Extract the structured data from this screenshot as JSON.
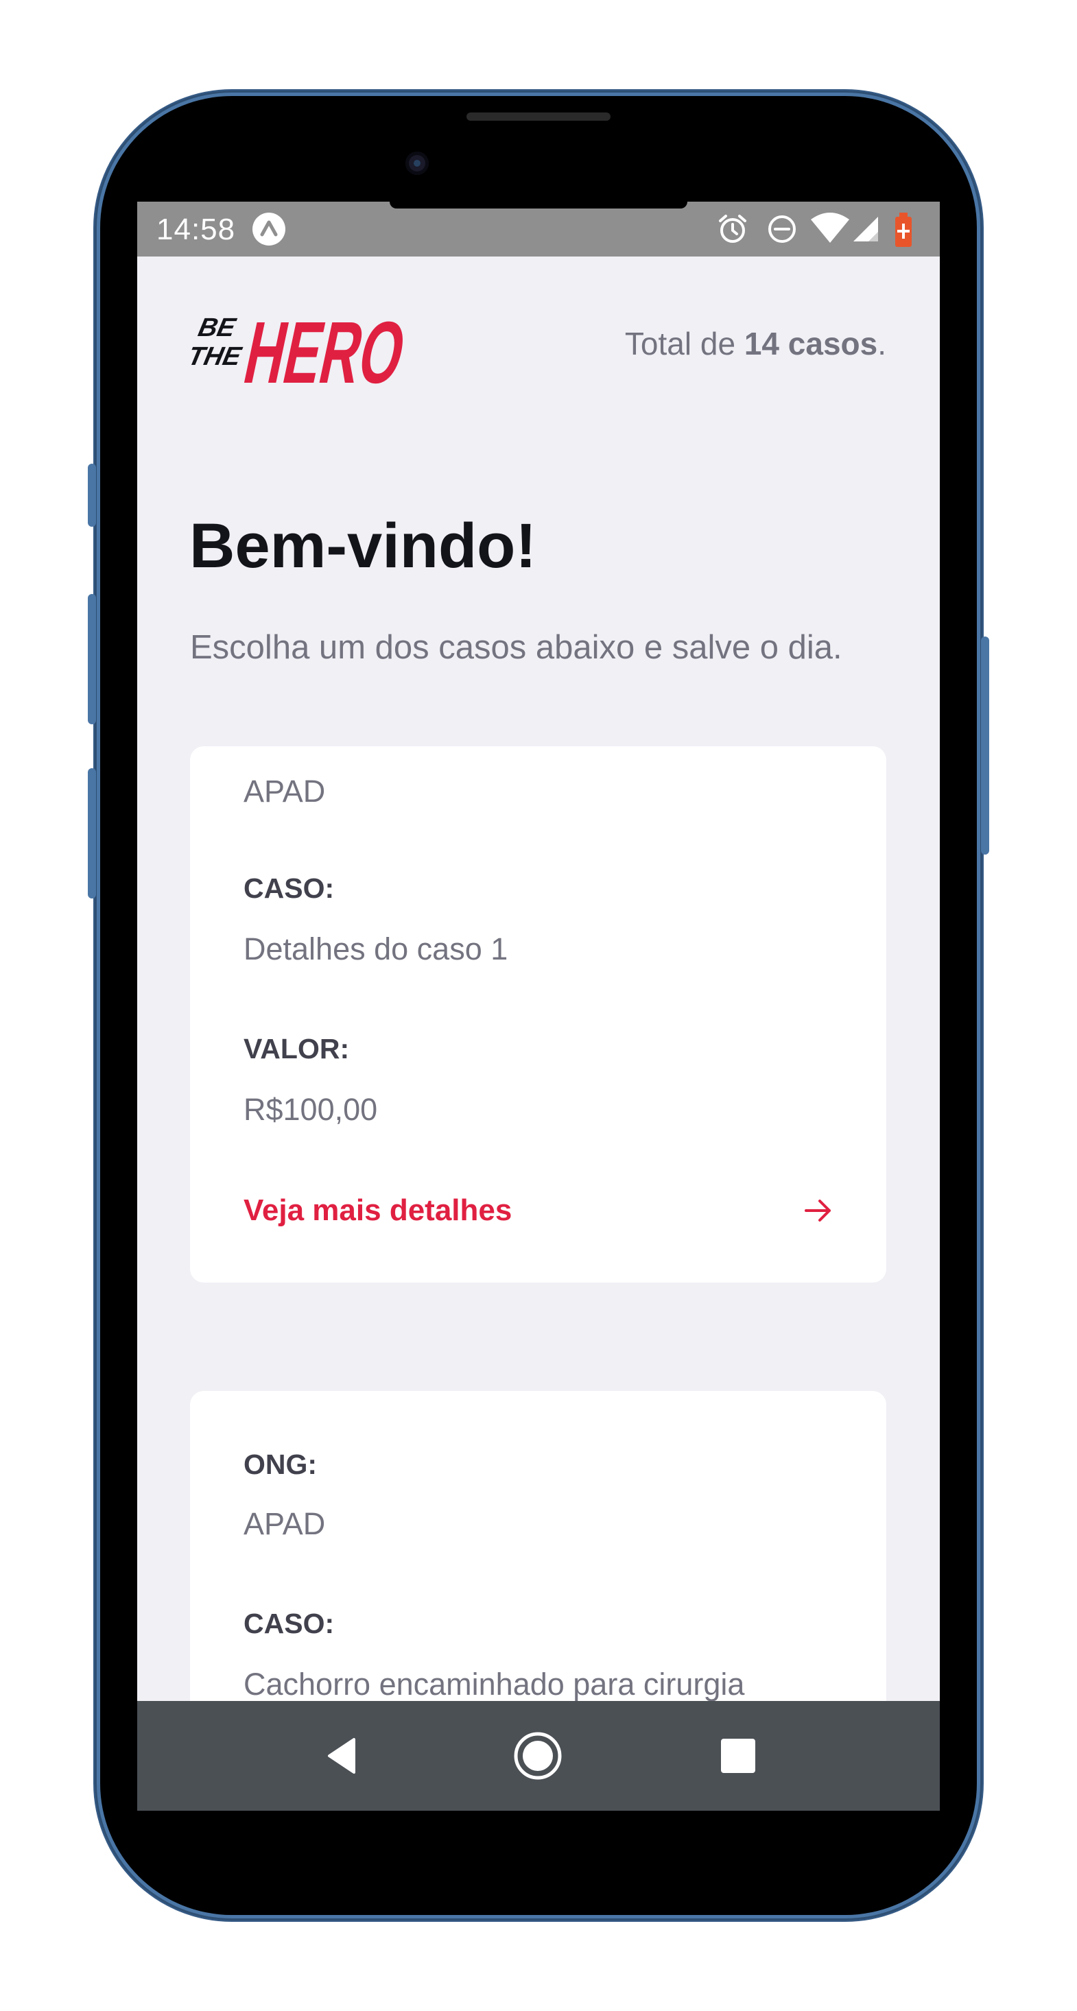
{
  "statusbar": {
    "time": "14:58",
    "icons": [
      "app-notification-icon",
      "alarm-icon",
      "do-not-disturb-icon",
      "wifi-icon",
      "signal-icon",
      "battery-icon"
    ]
  },
  "header": {
    "logo_text_small": "BE THE",
    "logo_text_big": "HERO",
    "total_prefix": "Total de ",
    "total_count": "14 casos",
    "total_suffix": "."
  },
  "welcome": {
    "title": "Bem-vindo!",
    "subtitle": "Escolha um dos casos abaixo e salve o dia."
  },
  "incidents": [
    {
      "ong_value": "APAD",
      "case_label": "CASO:",
      "case_value": "Detalhes do caso 1",
      "value_label": "VALOR:",
      "value_value": "R$100,00",
      "details_label": "Veja mais detalhes"
    },
    {
      "ong_label": "ONG:",
      "ong_value": "APAD",
      "case_label": "CASO:",
      "case_value": "Cachorro encaminhado para cirurgia"
    }
  ],
  "navbar": {
    "buttons": [
      "back-icon",
      "home-icon",
      "recents-icon"
    ]
  },
  "colors": {
    "brand": "#e02041",
    "background": "#f0f0f5",
    "text_dark": "#13131a",
    "text_muted": "#737380",
    "label": "#41414d",
    "statusbar": "#8f8f8f",
    "navbar": "#4b5055",
    "phone_frame": "#4a76a6"
  }
}
